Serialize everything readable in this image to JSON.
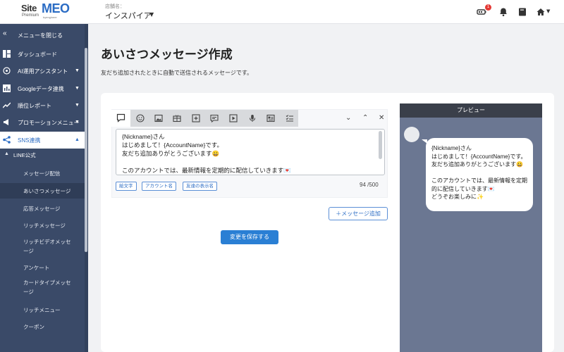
{
  "header": {
    "logo": {
      "site": "Site",
      "meo": "MEO",
      "premium": "Premium",
      "sub": "byengineer"
    },
    "store_label": "店舗名：",
    "store_name": "インスパイア",
    "notification_count": "1"
  },
  "sidebar": {
    "collapse_label": "メニューを閉じる",
    "items": [
      {
        "label": "ダッシュボード",
        "icon": "dashboard-icon"
      },
      {
        "label": "AI運用アシスタント",
        "icon": "ai-icon"
      },
      {
        "label": "Googleデータ連携",
        "icon": "chart-icon"
      },
      {
        "label": "順位レポート",
        "icon": "trend-icon"
      },
      {
        "label": "プロモーションメニュー",
        "icon": "megaphone-icon"
      },
      {
        "label": "SNS連携",
        "icon": "share-icon"
      }
    ],
    "section": "LINE公式",
    "sub_items": [
      "メッセージ配信",
      "あいさつメッセージ",
      "応答メッセージ",
      "リッチメッセージ",
      "リッチビデオメッセージ",
      "アンケート",
      "カードタイプメッセージ",
      "リッチメニュー",
      "クーポン"
    ]
  },
  "main": {
    "title": "あいさつメッセージ作成",
    "description": "友だち追加されたときに自動で送信されるメッセージです。",
    "message_text": "{Nickname}さん\nはじめまして！{AccountName}です。\n友だち追加ありがとうございます😀\n\nこのアカウントでは、最新情報を定期的に配信していきます💌",
    "chips": [
      "絵文字",
      "アカウント名",
      "友達の表示名"
    ],
    "counter": "94 /500",
    "add_button": "＋メッセージ追加",
    "save_button": "変更を保存する"
  },
  "preview": {
    "title": "プレビュー",
    "message": "{Nickname}さん\nはじめまして！{AccountName}です。\n友だち追加ありがとうございます😀\n\nこのアカウントでは、最新情報を定期的に配信していきます💌\nどうぞお楽しみに✨"
  },
  "colors": {
    "sidebar_bg": "#3a4a68",
    "accent": "#2a7fd4",
    "preview_bg": "#6b7792",
    "preview_header": "#3a3f4a"
  }
}
